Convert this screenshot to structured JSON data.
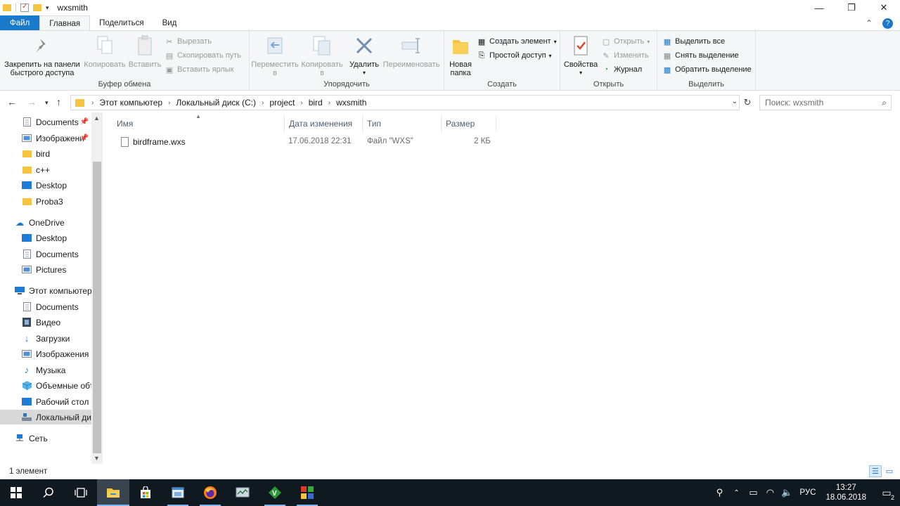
{
  "window": {
    "title": "wxsmith",
    "controls": {
      "minimize": "—",
      "maximize": "❐",
      "close": "✕"
    }
  },
  "tabs": {
    "file": "Файл",
    "home": "Главная",
    "share": "Поделиться",
    "view": "Вид"
  },
  "ribbon": {
    "clipboard": {
      "label": "Буфер обмена",
      "pin": "Закрепить на панели быстрого доступа",
      "copy": "Копировать",
      "paste": "Вставить",
      "cut": "Вырезать",
      "copy_path": "Скопировать путь",
      "paste_shortcut": "Вставить ярлык"
    },
    "organize": {
      "label": "Упорядочить",
      "move_to": "Переместить в",
      "copy_to": "Копировать в",
      "delete": "Удалить",
      "rename": "Переименовать"
    },
    "create": {
      "label": "Создать",
      "new_folder": "Новая папка",
      "new_item": "Создать элемент",
      "easy_access": "Простой доступ"
    },
    "open": {
      "label": "Открыть",
      "properties": "Свойства",
      "open": "Открыть",
      "edit": "Изменить",
      "history": "Журнал"
    },
    "select": {
      "label": "Выделить",
      "select_all": "Выделить все",
      "select_none": "Снять выделение",
      "invert": "Обратить выделение"
    }
  },
  "address": {
    "crumbs": [
      "Этот компьютер",
      "Локальный диск (C:)",
      "project",
      "bird",
      "wxsmith"
    ],
    "search_placeholder": "Поиск: wxsmith"
  },
  "nav": {
    "items": [
      {
        "label": "Documents",
        "icon": "documents-icon",
        "pinned": true
      },
      {
        "label": "Изображени",
        "icon": "pictures-icon",
        "pinned": true
      },
      {
        "label": "bird",
        "icon": "folder-icon"
      },
      {
        "label": "c++",
        "icon": "folder-icon"
      },
      {
        "label": "Desktop",
        "icon": "desktop-icon"
      },
      {
        "label": "Proba3",
        "icon": "folder-icon"
      },
      {
        "label": "OneDrive",
        "icon": "cloud-icon"
      },
      {
        "label": "Desktop",
        "icon": "desktop-icon"
      },
      {
        "label": "Documents",
        "icon": "documents-icon"
      },
      {
        "label": "Pictures",
        "icon": "pictures-icon"
      },
      {
        "label": "Этот компьютер",
        "icon": "computer-icon"
      },
      {
        "label": "Documents",
        "icon": "documents-icon"
      },
      {
        "label": "Видео",
        "icon": "video-icon"
      },
      {
        "label": "Загрузки",
        "icon": "download-icon"
      },
      {
        "label": "Изображения",
        "icon": "pictures-icon"
      },
      {
        "label": "Музыка",
        "icon": "music-icon"
      },
      {
        "label": "Объемные объ",
        "icon": "3d-objects-icon"
      },
      {
        "label": "Рабочий стол",
        "icon": "desktop-icon"
      },
      {
        "label": "Локальный дис",
        "icon": "drive-icon",
        "selected": true
      },
      {
        "label": "Сеть",
        "icon": "network-icon"
      }
    ]
  },
  "files": {
    "columns": {
      "name": "Имя",
      "date": "Дата изменения",
      "type": "Тип",
      "size": "Размер"
    },
    "rows": [
      {
        "name": "birdframe.wxs",
        "date": "17.06.2018 22:31",
        "type": "Файл \"WXS\"",
        "size": "2 КБ"
      }
    ]
  },
  "status": {
    "count": "1 элемент"
  },
  "taskbar": {
    "lang": "РУС",
    "time": "13:27",
    "date": "18.06.2018",
    "notifications": "2"
  },
  "colors": {
    "accent": "#1979ca",
    "folder": "#f5c542",
    "taskbar": "#101820"
  }
}
